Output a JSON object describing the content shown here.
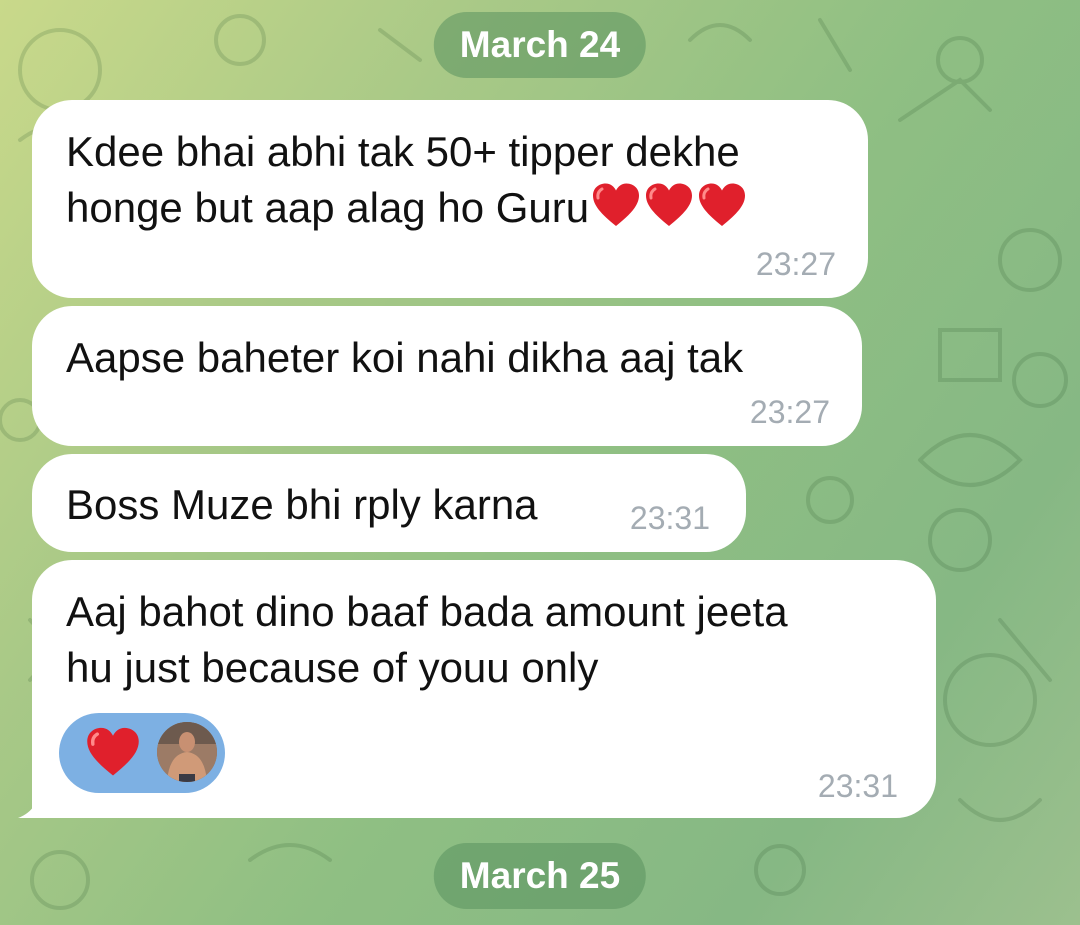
{
  "dates": {
    "first": "March 24",
    "second": "March 25"
  },
  "messages": [
    {
      "lines": [
        "Kdee bhai abhi tak 50+ tipper dekhe",
        "honge but aap alag ho Guru"
      ],
      "trailing_emoji": "red-heart x3",
      "time": "23:27"
    },
    {
      "lines": [
        "Aapse baheter koi nahi dikha aaj tak"
      ],
      "time": "23:27"
    },
    {
      "lines": [
        "Boss Muze bhi rply karna"
      ],
      "time": "23:31"
    },
    {
      "lines": [
        "Aaj bahot dino baaf bada amount jeeta",
        "hu just because of youu only"
      ],
      "time": "23:31",
      "reaction": {
        "emoji": "red-heart",
        "reactor": "avatar"
      }
    }
  ],
  "colors": {
    "bubble": "#ffffff",
    "date_pill": "#5a915f",
    "timestamp": "#a4acb3",
    "reaction_pill": "#7db0e3",
    "heart": "#e0202c"
  },
  "icons": [
    "red-heart-emoji",
    "user-avatar"
  ]
}
